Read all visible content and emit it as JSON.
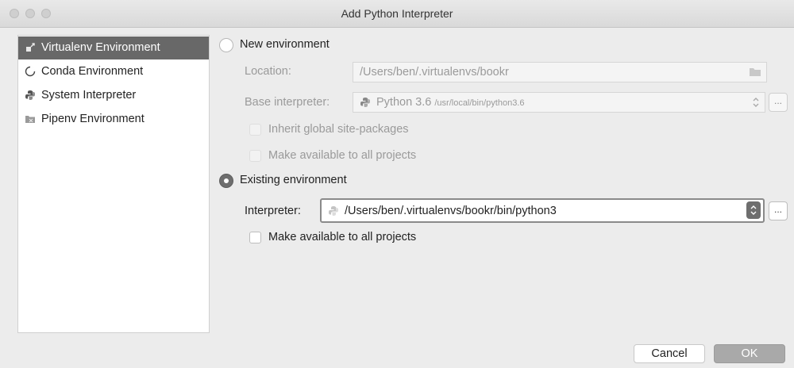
{
  "window": {
    "title": "Add Python Interpreter"
  },
  "sidebar": {
    "items": [
      {
        "label": "Virtualenv Environment",
        "icon": "virtualenv-icon",
        "selected": true
      },
      {
        "label": "Conda Environment",
        "icon": "conda-icon",
        "selected": false
      },
      {
        "label": "System Interpreter",
        "icon": "python-icon",
        "selected": false
      },
      {
        "label": "Pipenv Environment",
        "icon": "pipenv-icon",
        "selected": false
      }
    ]
  },
  "new_env": {
    "label": "New environment",
    "selected": false,
    "location_label": "Location:",
    "location_value": "/Users/ben/.virtualenvs/bookr",
    "base_label": "Base interpreter:",
    "base_value": "Python 3.6",
    "base_path": "/usr/local/bin/python3.6",
    "inherit_label": "Inherit global site-packages",
    "make_available_label": "Make available to all projects"
  },
  "existing_env": {
    "label": "Existing environment",
    "selected": true,
    "interpreter_label": "Interpreter:",
    "interpreter_value": "/Users/ben/.virtualenvs/bookr/bin/python3",
    "make_available_label": "Make available to all projects"
  },
  "buttons": {
    "ellipsis": "...",
    "cancel": "Cancel",
    "ok": "OK"
  }
}
